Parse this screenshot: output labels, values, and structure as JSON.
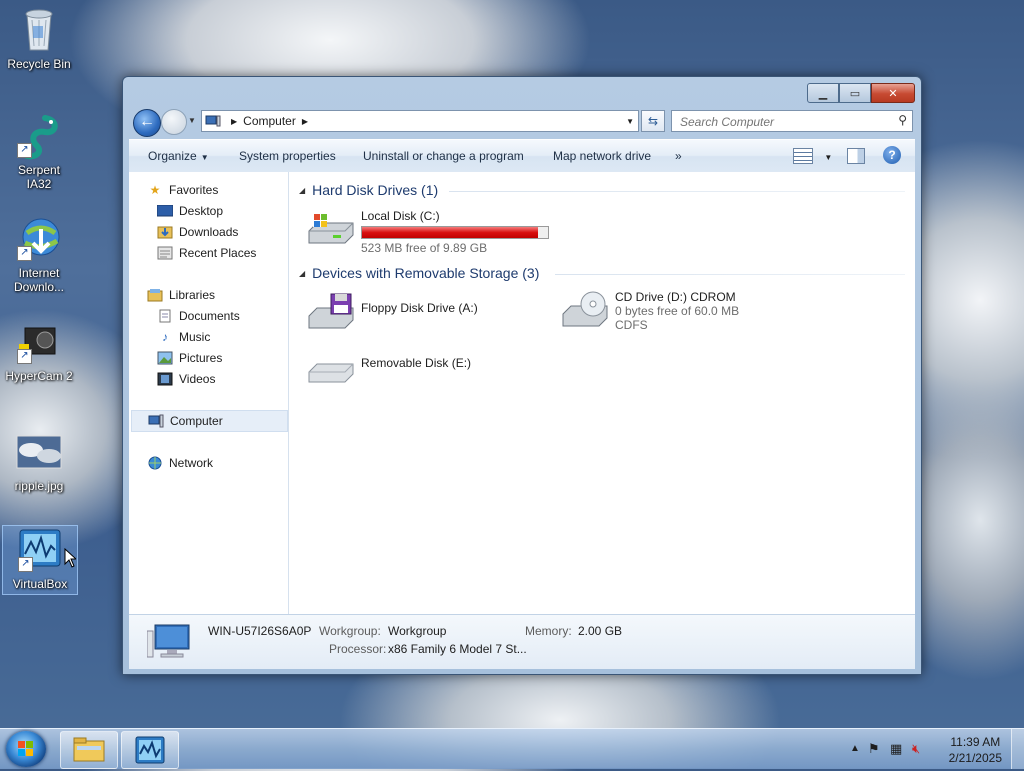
{
  "desktop": {
    "icons": [
      {
        "label": "Recycle Bin"
      },
      {
        "label": "Serpent IA32"
      },
      {
        "label": "Internet Downlo..."
      },
      {
        "label": "HyperCam 2"
      },
      {
        "label": "ripple.jpg"
      },
      {
        "label": "VirtualBox"
      }
    ]
  },
  "window": {
    "address": {
      "crumb": "Computer"
    },
    "search": {
      "placeholder": "Search Computer"
    },
    "toolbar": {
      "organize": "Organize",
      "system_properties": "System properties",
      "uninstall": "Uninstall or change a program",
      "map_drive": "Map network drive",
      "more": "»"
    },
    "nav": {
      "favorites": "Favorites",
      "desktop": "Desktop",
      "downloads": "Downloads",
      "recent": "Recent Places",
      "libraries": "Libraries",
      "documents": "Documents",
      "music": "Music",
      "pictures": "Pictures",
      "videos": "Videos",
      "computer": "Computer",
      "network": "Network"
    },
    "groups": {
      "hdd": "Hard Disk Drives (1)",
      "removable": "Devices with Removable Storage (3)"
    },
    "drives": {
      "c": {
        "name": "Local Disk (C:)",
        "free": "523 MB free of 9.89 GB",
        "used_fraction": 0.948
      },
      "a": {
        "name": "Floppy Disk Drive (A:)"
      },
      "d": {
        "name": "CD Drive (D:) CDROM",
        "free": "0 bytes free of 60.0 MB",
        "fs": "CDFS"
      },
      "e": {
        "name": "Removable Disk (E:)"
      }
    },
    "details": {
      "computer_name": "WIN-U57I26S6A0P",
      "workgroup_label": "Workgroup:",
      "workgroup": "Workgroup",
      "memory_label": "Memory:",
      "memory": "2.00 GB",
      "processor_label": "Processor:",
      "processor": "x86 Family 6 Model 7 St..."
    }
  },
  "taskbar": {
    "time": "11:39 AM",
    "date": "2/21/2025"
  },
  "colors": {
    "accent": "#1e3b6e",
    "disk_bar": "#d80f0f"
  }
}
